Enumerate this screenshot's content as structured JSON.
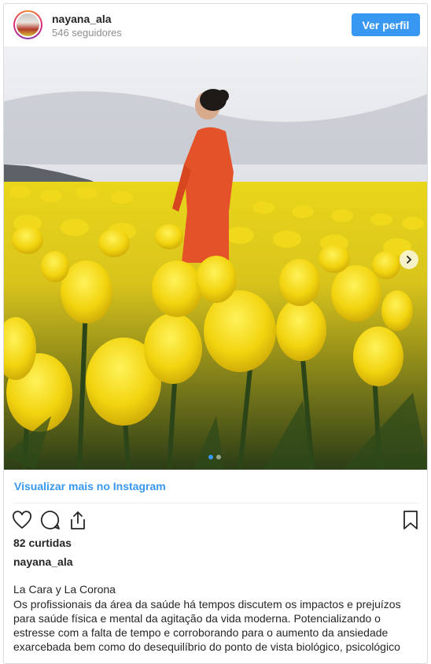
{
  "header": {
    "username": "nayana_ala",
    "followers": "546 seguidores",
    "profile_button": "Ver perfil"
  },
  "photo": {
    "carousel_count": 2,
    "carousel_active": 1,
    "next_icon": "chevron-right-icon"
  },
  "more_link": "Visualizar mais no Instagram",
  "actions": {
    "icons": [
      "heart-icon",
      "comment-icon",
      "share-icon",
      "bookmark-icon"
    ]
  },
  "likes": "82 curtidas",
  "caption": {
    "username": "nayana_ala",
    "title": "La Cara y La Corona",
    "lines": [
      "Os profissionais da área da saúde há tempos discutem os impactos e prejuízos",
      "para saúde física e mental da agitação da vida moderna. Potencializando o",
      "estresse com a falta de tempo e corroborando para o aumento da ansiedade",
      "exarcebada  bem como do desequilíbrio do ponto de vista biológico, psicológico"
    ]
  },
  "colors": {
    "accent": "#3897f0",
    "text": "#262626",
    "muted": "#8e8e8e",
    "border": "#dbdbdb"
  }
}
